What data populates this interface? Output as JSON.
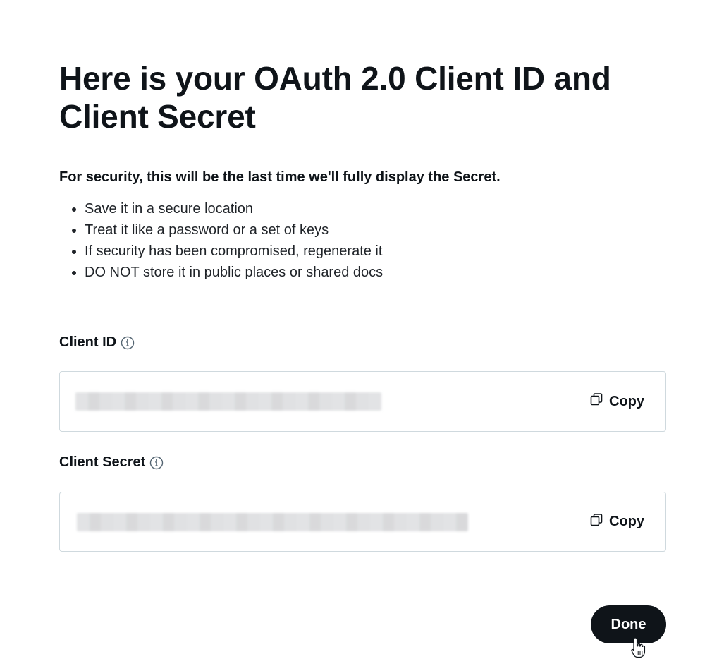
{
  "header": {
    "title": "Here is your OAuth 2.0 Client ID and Client Secret"
  },
  "notice": {
    "warning": "For security, this will be the last time we'll fully display the Secret.",
    "tips": [
      "Save it in a secure location",
      "Treat it like a password or a set of keys",
      "If security has been compromised, regenerate it",
      "DO NOT store it in public places or shared docs"
    ]
  },
  "client_id": {
    "label": "Client ID",
    "info_icon": "info-icon",
    "copy_label": "Copy",
    "copy_icon": "copy-icon"
  },
  "client_secret": {
    "label": "Client Secret",
    "info_icon": "info-icon",
    "copy_label": "Copy",
    "copy_icon": "copy-icon"
  },
  "footer": {
    "done_label": "Done"
  },
  "colors": {
    "text": "#0f1419",
    "border": "#cfd9de",
    "button_bg": "#0f1419",
    "button_text": "#ffffff"
  }
}
